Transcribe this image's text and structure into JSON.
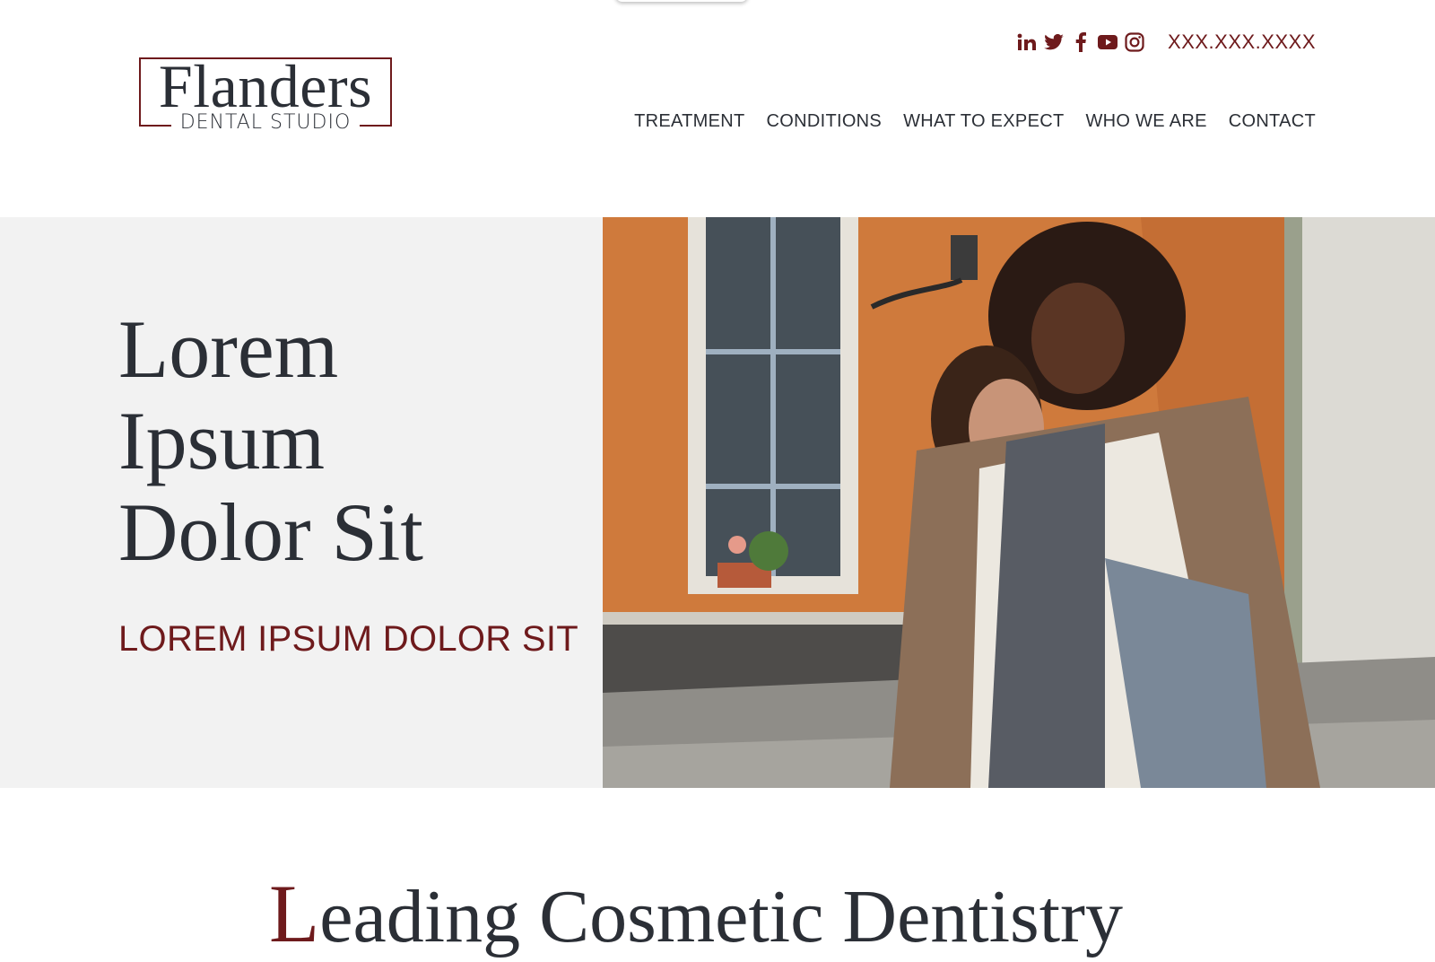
{
  "header": {
    "logo": {
      "name": "Flanders",
      "sub": "DENTAL STUDIO"
    },
    "social": [
      {
        "icon": "linkedin-icon",
        "label": "in"
      },
      {
        "icon": "twitter-icon"
      },
      {
        "icon": "facebook-icon",
        "label": "f"
      },
      {
        "icon": "youtube-icon"
      },
      {
        "icon": "instagram-icon"
      }
    ],
    "phone": "XXX.XXX.XXXX",
    "nav": [
      "TREATMENT",
      "CONDITIONS",
      "WHAT TO EXPECT",
      "WHO WE ARE",
      "CONTACT"
    ]
  },
  "hero": {
    "title_lines": [
      "Lorem",
      "Ipsum",
      "Dolor Sit"
    ],
    "subtitle": "LOREM IPSUM DOLOR SIT"
  },
  "section": {
    "dropcap": "L",
    "heading_rest": "eading Cosmetic Dentistry"
  },
  "colors": {
    "accent": "#6e1a1c",
    "text": "#2b2f36",
    "hero_panel": "#f2f2f2",
    "photo_wall": "#cf7a3c"
  }
}
